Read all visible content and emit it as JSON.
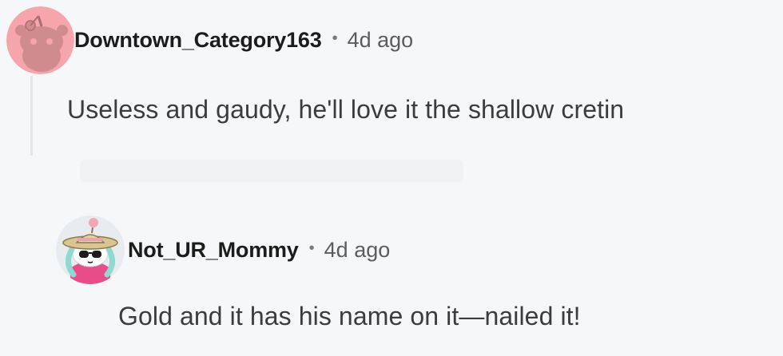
{
  "comments": [
    {
      "username": "Downtown_Category163",
      "separator": "•",
      "time": "4d ago",
      "text": "Useless and gaudy, he'll love it the shallow cretin",
      "avatar_icon": "reddit-snoo-avatar-icon",
      "avatar_bg": "#f6a5ad"
    },
    {
      "username": "Not_UR_Mommy",
      "separator": "•",
      "time": "4d ago",
      "text": "Gold and it has his name on it—nailed it!",
      "avatar_icon": "snoo-sunhat-avatar-icon",
      "avatar_bg": "#e9ecef"
    }
  ]
}
